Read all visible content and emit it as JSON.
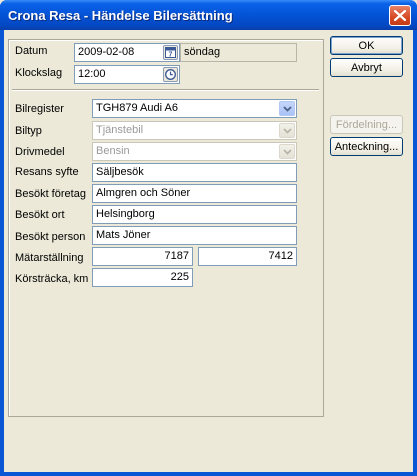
{
  "window": {
    "title": "Crona Resa - Händelse Bilersättning"
  },
  "buttons": {
    "ok": "OK",
    "cancel": "Avbryt",
    "distribution": "Fördelning...",
    "note": "Anteckning..."
  },
  "form": {
    "date_label": "Datum",
    "date_value": "2009-02-08",
    "calendar_icon_text": "7",
    "weekday": "söndag",
    "time_label": "Klockslag",
    "time_value": "12:00",
    "car_register_label": "Bilregister",
    "car_register_value": "TGH879 Audi A6",
    "car_type_label": "Biltyp",
    "car_type_value": "Tjänstebil",
    "fuel_label": "Drivmedel",
    "fuel_value": "Bensin",
    "purpose_label": "Resans syfte",
    "purpose_value": "Säljbesök",
    "company_label": "Besökt företag",
    "company_value": "Almgren och Söner",
    "location_label": "Besökt ort",
    "location_value": "Helsingborg",
    "person_label": "Besökt person",
    "person_value": "Mats Jöner",
    "odometer_label": "Mätarställning",
    "odometer_start": "7187",
    "odometer_end": "7412",
    "distance_label": "Körsträcka, km",
    "distance_value": "225"
  },
  "icons": {
    "close": "close-icon",
    "calendar": "calendar-icon",
    "clock": "clock-icon",
    "dropdown": "chevron-down-icon"
  },
  "colors": {
    "titlebar": "#0453d6",
    "close_button": "#d64a24",
    "dialog_bg": "#ece9d8",
    "disabled_text": "#9a9a9a"
  }
}
